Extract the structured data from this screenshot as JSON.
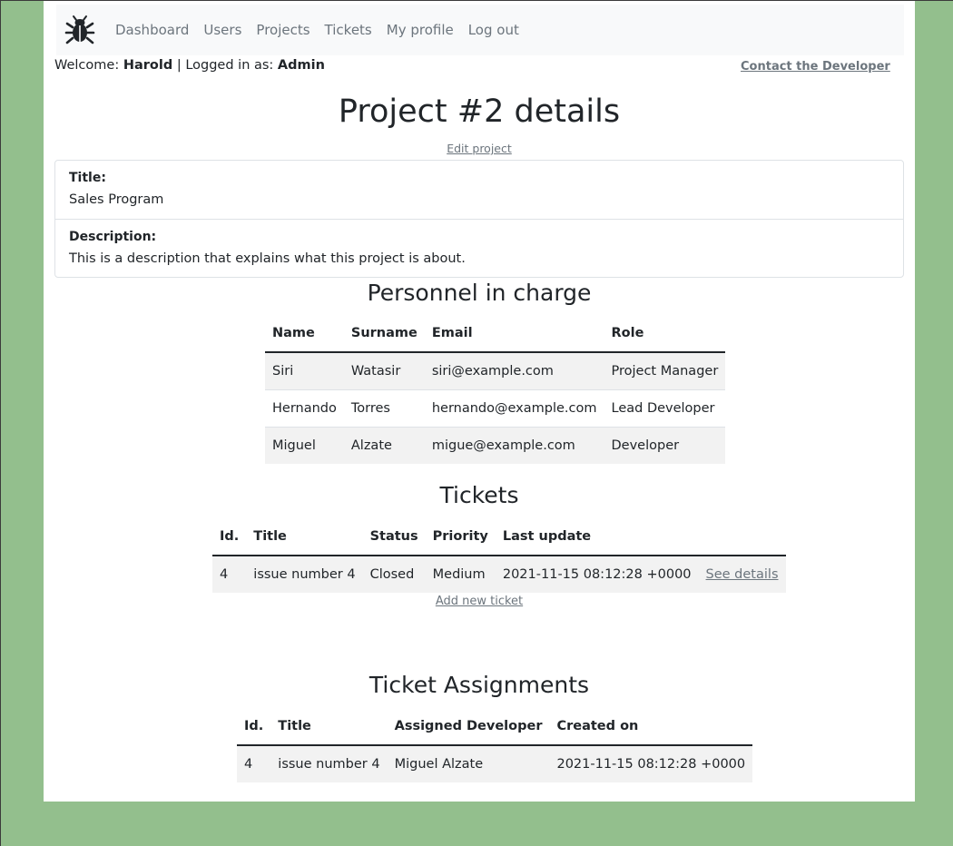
{
  "nav": {
    "brand_icon": "bug-icon",
    "items": [
      {
        "label": "Dashboard"
      },
      {
        "label": "Users"
      },
      {
        "label": "Projects"
      },
      {
        "label": "Tickets"
      },
      {
        "label": "My profile"
      },
      {
        "label": "Log out"
      }
    ]
  },
  "welcome": {
    "prefix": "Welcome: ",
    "user": "Harold",
    "separator": " | Logged in as: ",
    "role": "Admin"
  },
  "contact_link": "Contact the Developer",
  "page_title": "Project #2 details",
  "edit_link": "Edit project",
  "project": {
    "title_label": "Title:",
    "title_value": "Sales Program",
    "description_label": "Description:",
    "description_value": "This is a description that explains what this project is about."
  },
  "personnel": {
    "heading": "Personnel in charge",
    "columns": [
      "Name",
      "Surname",
      "Email",
      "Role"
    ],
    "rows": [
      [
        "Siri",
        "Watasir",
        "siri@example.com",
        "Project Manager"
      ],
      [
        "Hernando",
        "Torres",
        "hernando@example.com",
        "Lead Developer"
      ],
      [
        "Miguel",
        "Alzate",
        "migue@example.com",
        "Developer"
      ]
    ]
  },
  "tickets": {
    "heading": "Tickets",
    "columns": [
      "Id.",
      "Title",
      "Status",
      "Priority",
      "Last update"
    ],
    "rows": [
      {
        "id": "4",
        "title": "issue number 4",
        "status": "Closed",
        "priority": "Medium",
        "updated": "2021-11-15 08:12:28 +0000",
        "link": "See details"
      }
    ],
    "add_link": "Add new ticket"
  },
  "assignments": {
    "heading": "Ticket Assignments",
    "columns": [
      "Id.",
      "Title",
      "Assigned Developer",
      "Created on"
    ],
    "rows": [
      [
        "4",
        "issue number 4",
        "Miguel Alzate",
        "2021-11-15 08:12:28 +0000"
      ]
    ]
  },
  "colors": {
    "background": "#93bf8d",
    "navbar": "#f8f9fa",
    "muted_link": "#6c757d"
  }
}
